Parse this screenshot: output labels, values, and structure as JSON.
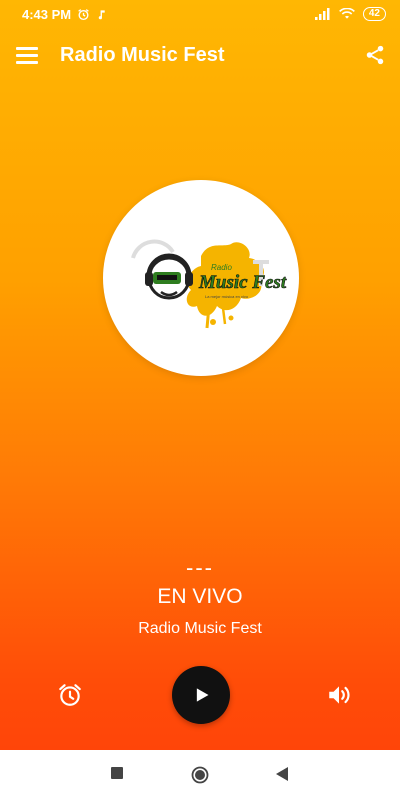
{
  "status_bar": {
    "time": "4:43 PM",
    "battery": "42",
    "icons": [
      "alarm-icon",
      "music-note-icon",
      "signal-icon",
      "wifi-icon",
      "battery-icon"
    ]
  },
  "app_bar": {
    "title": "Radio Music Fest",
    "icons": [
      "menu-icon",
      "share-icon"
    ]
  },
  "logo": {
    "text": "Music Fest",
    "small_text": "Radio",
    "tagline": "La mejor música en vivo"
  },
  "player": {
    "track": "---",
    "status": "EN VIVO",
    "station": "Radio Music Fest",
    "icons": [
      "alarm-icon",
      "play-icon",
      "volume-icon"
    ]
  },
  "colors": {
    "gradient_top": "#ffb703",
    "gradient_bottom": "#ff3f0a",
    "play_button": "#111111",
    "logo_green": "#2e7d1f",
    "logo_yellow": "#f5b400"
  },
  "nav_bar": {
    "icons": [
      "recents-square-icon",
      "home-circle-icon",
      "back-triangle-icon"
    ]
  }
}
